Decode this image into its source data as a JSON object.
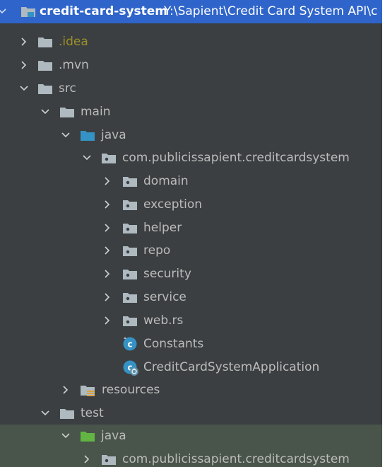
{
  "project": {
    "name": "credit-card-system",
    "path": "Y:\\Sapient\\Credit Card System API\\c"
  },
  "tree": [
    {
      "label": "credit-card-system",
      "icon": "module-folder-icon",
      "expanded": true
    },
    {
      "label": ".idea",
      "icon": "folder-icon",
      "expanded": false
    },
    {
      "label": ".mvn",
      "icon": "folder-icon",
      "expanded": false
    },
    {
      "label": "src",
      "icon": "folder-icon",
      "expanded": true
    },
    {
      "label": "main",
      "icon": "folder-icon",
      "expanded": true
    },
    {
      "label": "java",
      "icon": "source-root-folder-icon",
      "expanded": true
    },
    {
      "label": "com.publicissapient.creditcardsystem",
      "icon": "package-icon",
      "expanded": true
    },
    {
      "label": "domain",
      "icon": "package-icon",
      "expanded": false
    },
    {
      "label": "exception",
      "icon": "package-icon",
      "expanded": false
    },
    {
      "label": "helper",
      "icon": "package-icon",
      "expanded": false
    },
    {
      "label": "repo",
      "icon": "package-icon",
      "expanded": false
    },
    {
      "label": "security",
      "icon": "package-icon",
      "expanded": false
    },
    {
      "label": "service",
      "icon": "package-icon",
      "expanded": false
    },
    {
      "label": "web.rs",
      "icon": "package-icon",
      "expanded": false
    },
    {
      "label": "Constants",
      "icon": "class-icon"
    },
    {
      "label": "CreditCardSystemApplication",
      "icon": "spring-boot-class-icon"
    },
    {
      "label": "resources",
      "icon": "resources-folder-icon",
      "expanded": false
    },
    {
      "label": "test",
      "icon": "folder-icon",
      "expanded": true
    },
    {
      "label": "java",
      "icon": "test-root-folder-icon",
      "expanded": true
    },
    {
      "label": "com.publicissapient.creditcardsystem",
      "icon": "package-icon",
      "expanded": false
    }
  ],
  "colors": {
    "background": "#3c3f41",
    "selection": "#2f65ca",
    "test_highlight": "#49544a",
    "folder": "#aeb9c0",
    "source_root": "#3592c4",
    "test_root": "#62b543",
    "idea_text": "#9b8f2a"
  }
}
